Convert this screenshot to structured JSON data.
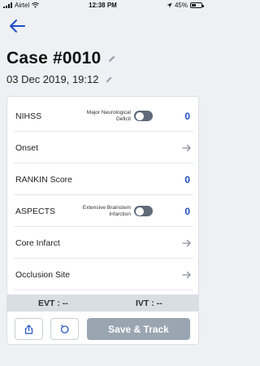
{
  "status_bar": {
    "carrier": "Airtel",
    "time": "12:38 PM",
    "battery": "45%"
  },
  "header": {
    "title": "Case #0010",
    "datetime": "03 Dec 2019, 19:12"
  },
  "rows": [
    {
      "label": "NIHSS",
      "sub_label": "Major Neurological Deficit",
      "toggle_on": false,
      "value": "0"
    },
    {
      "label": "Onset"
    },
    {
      "label": "RANKIN Score",
      "value": "0"
    },
    {
      "label": "ASPECTS",
      "sub_label": "Extensive Brainstem Infarction",
      "toggle_on": false,
      "value": "0"
    },
    {
      "label": "Core Infarct"
    },
    {
      "label": "Occlusion Site"
    }
  ],
  "summary": {
    "evt": "EVT : --",
    "ivt": "IVT : --"
  },
  "footer": {
    "save_label": "Save & Track"
  },
  "colors": {
    "accent": "#1e4fc2",
    "toggle_off": "#5f6b78",
    "save_disabled": "#9aa5b2",
    "summary_bg": "#d9dee5"
  }
}
